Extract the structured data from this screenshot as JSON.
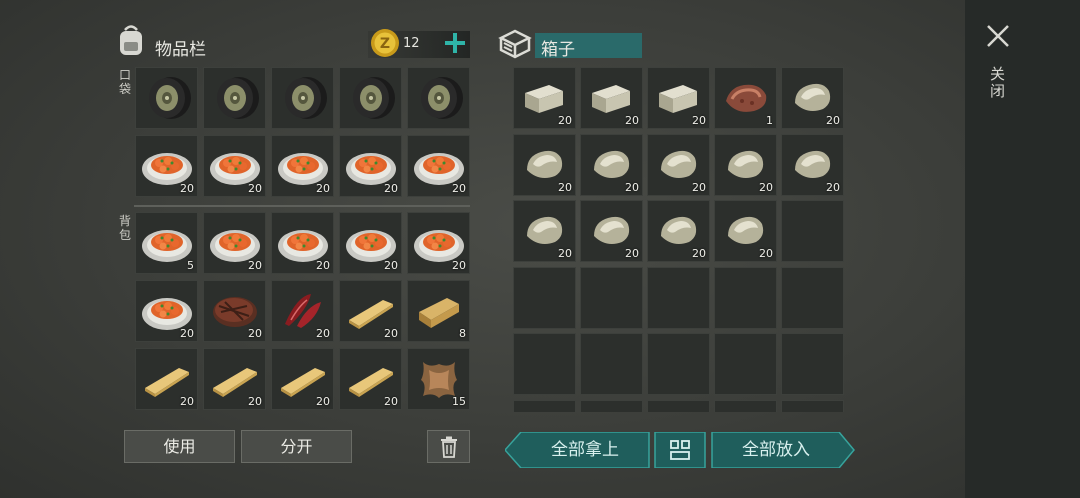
{
  "inventory": {
    "title": "物品栏",
    "coins": "12",
    "pocket_label": "口袋",
    "backpack_label": "背包",
    "pocket": [
      {
        "icon": "tire-icon",
        "count": ""
      },
      {
        "icon": "tire-icon",
        "count": ""
      },
      {
        "icon": "tire-icon",
        "count": ""
      },
      {
        "icon": "tire-icon",
        "count": ""
      },
      {
        "icon": "tire-icon",
        "count": ""
      },
      {
        "icon": "food-plate-icon",
        "count": "20"
      },
      {
        "icon": "food-plate-icon",
        "count": "20"
      },
      {
        "icon": "food-plate-icon",
        "count": "20"
      },
      {
        "icon": "food-plate-icon",
        "count": "20"
      },
      {
        "icon": "food-plate-icon",
        "count": "20"
      }
    ],
    "backpack": [
      {
        "icon": "food-plate-icon",
        "count": "5"
      },
      {
        "icon": "food-plate-icon",
        "count": "20"
      },
      {
        "icon": "food-plate-icon",
        "count": "20"
      },
      {
        "icon": "food-plate-icon",
        "count": "20"
      },
      {
        "icon": "food-plate-icon",
        "count": "20"
      },
      {
        "icon": "food-plate-icon",
        "count": "20"
      },
      {
        "icon": "steak-icon",
        "count": "20"
      },
      {
        "icon": "raw-meat-icon",
        "count": "20"
      },
      {
        "icon": "plank-icon",
        "count": "20"
      },
      {
        "icon": "log-icon",
        "count": "8"
      },
      {
        "icon": "plank-icon",
        "count": "20"
      },
      {
        "icon": "plank-icon",
        "count": "20"
      },
      {
        "icon": "plank-icon",
        "count": "20"
      },
      {
        "icon": "plank-icon",
        "count": "20"
      },
      {
        "icon": "leather-icon",
        "count": "15"
      }
    ]
  },
  "box": {
    "title": "箱子",
    "slots": [
      {
        "icon": "stone-brick-icon",
        "count": "20"
      },
      {
        "icon": "stone-brick-icon",
        "count": "20"
      },
      {
        "icon": "stone-brick-icon",
        "count": "20"
      },
      {
        "icon": "iron-ore-icon",
        "count": "1"
      },
      {
        "icon": "stone-icon",
        "count": "20"
      },
      {
        "icon": "stone-icon",
        "count": "20"
      },
      {
        "icon": "stone-icon",
        "count": "20"
      },
      {
        "icon": "stone-icon",
        "count": "20"
      },
      {
        "icon": "stone-icon",
        "count": "20"
      },
      {
        "icon": "stone-icon",
        "count": "20"
      },
      {
        "icon": "stone-icon",
        "count": "20"
      },
      {
        "icon": "stone-icon",
        "count": "20"
      },
      {
        "icon": "stone-icon",
        "count": "20"
      },
      {
        "icon": "stone-icon",
        "count": "20"
      },
      {
        "icon": "",
        "count": ""
      },
      {
        "icon": "",
        "count": ""
      },
      {
        "icon": "",
        "count": ""
      },
      {
        "icon": "",
        "count": ""
      },
      {
        "icon": "",
        "count": ""
      },
      {
        "icon": "",
        "count": ""
      },
      {
        "icon": "",
        "count": ""
      },
      {
        "icon": "",
        "count": ""
      },
      {
        "icon": "",
        "count": ""
      },
      {
        "icon": "",
        "count": ""
      },
      {
        "icon": "",
        "count": ""
      }
    ]
  },
  "buttons": {
    "use": "使用",
    "split": "分开",
    "take_all": "全部拿上",
    "put_all": "全部放入",
    "close": "关闭"
  }
}
